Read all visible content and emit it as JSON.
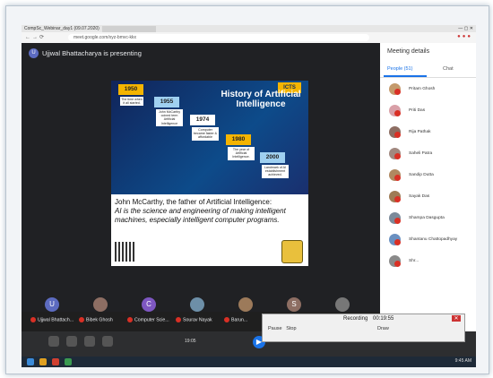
{
  "window": {
    "title": "CompSc_Webinar_day1 (09.07.2020)",
    "url": "meet.google.com/xyz-bmvc-kkx"
  },
  "meet": {
    "presenter_text": "Ujjwal Bhattacharya is presenting",
    "presenter_initial": "U"
  },
  "slide": {
    "title": "History of Artificial Intelligence",
    "badge": "ICTS",
    "years": [
      "1950",
      "1955",
      "1974",
      "1980",
      "2000"
    ],
    "notes": [
      "The time when it all started.",
      "John McCarthy coined term Artificial Intelligence",
      "Computer became faster & affordable",
      "The year of Artificial Intelligence.",
      "Landmark of AI establishment achieved."
    ],
    "line1": "John McCarthy, the father of Artificial Intelligence:",
    "line2": "AI is the science and engineering of making intelligent",
    "line3": "machines, especially intelligent computer programs."
  },
  "participants_strip": [
    {
      "initial": "U",
      "name": "Ujjwal Bhattach...",
      "color": "#5c6bc0"
    },
    {
      "initial": "",
      "name": "Bibek Ghosh",
      "color": "#8d6e63"
    },
    {
      "initial": "C",
      "name": "Computer Scie...",
      "color": "#7e57c2"
    },
    {
      "initial": "",
      "name": "Sourav Nayak",
      "color": "#6d8fa8"
    },
    {
      "initial": "",
      "name": "Barun...",
      "color": "#9c7a5a"
    },
    {
      "initial": "S",
      "name": "",
      "color": "#8d6e63"
    },
    {
      "initial": "",
      "name": "",
      "color": "#777777"
    }
  ],
  "side_panel": {
    "heading": "Meeting details",
    "people_tab": "People (51)",
    "chat_tab": "Chat",
    "people": [
      {
        "name": "Pritam Ghosh",
        "color": "#c49a6c"
      },
      {
        "name": "Priti Das",
        "color": "#d9a0a8"
      },
      {
        "name": "Rija Pathak",
        "color": "#8d6e63"
      },
      {
        "name": "Saheli Patra",
        "color": "#a1887f"
      },
      {
        "name": "Sandip Dutta",
        "color": "#b08860"
      },
      {
        "name": "Sayak Das",
        "color": "#9e7b55"
      },
      {
        "name": "Shampa Dasgupta",
        "color": "#7b8a9a"
      },
      {
        "name": "Shantanu Chattopadhyay",
        "color": "#6a90c0"
      },
      {
        "name": "Shr...",
        "color": "#8a8a8a"
      }
    ]
  },
  "player": {
    "time": "19:05"
  },
  "recorder": {
    "title": "Recording",
    "elapsed": "00:19:55",
    "pause_label": "Pause",
    "stop_label": "Stop",
    "draw_label": "Draw"
  },
  "taskbar": {
    "clock": "9:45 AM"
  }
}
